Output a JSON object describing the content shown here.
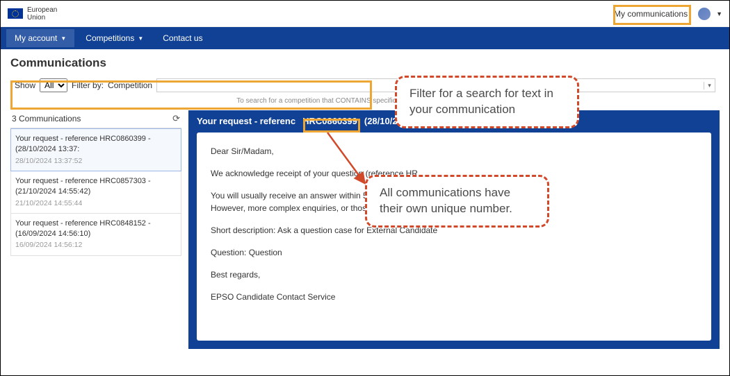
{
  "header": {
    "org_l1": "European",
    "org_l2": "Union",
    "my_comms": "My communications"
  },
  "nav": {
    "account": "My account",
    "competitions": "Competitions",
    "contact": "Contact us"
  },
  "page": {
    "title": "Communications",
    "show_label": "Show",
    "show_value": "All",
    "filter_label": "Filter by:",
    "filter_field": "Competition",
    "filter_hint": "To search for a competition that CONTAINS specific text, enter * before your search"
  },
  "sidebar": {
    "count_label": "3 Communications",
    "items": [
      {
        "title": "Your request - reference HRC0860399 - (28/10/2024 13:37:",
        "sub": "28/10/2024 13:37:52"
      },
      {
        "title": "Your request - reference HRC0857303 - (21/10/2024 14:55:42)",
        "sub": "21/10/2024 14:55:44"
      },
      {
        "title": "Your request - reference HRC0848152 - (16/09/2024 14:56:10)",
        "sub": "16/09/2024 14:56:12"
      }
    ]
  },
  "detail": {
    "h_prefix": "Your request - referenc",
    "h_ref": "HRC0860399",
    "h_suffix": "(28/10/2024 13:",
    "body": {
      "p1": "Dear Sir/Madam,",
      "p2": "We acknowledge receipt of your question (reference HR",
      "p3a": "You will usually receive an answer within 5 working days",
      "p3b": "However, more complex enquiries, or those requiring tr",
      "p4": "Short description: Ask a question case for External Candidate",
      "p5": "Question: Question",
      "p6": "Best regards,",
      "p7": "EPSO Candidate Contact Service"
    }
  },
  "callouts": {
    "c1": "Filter for a search for text in your communication",
    "c2": "All communications have their own unique number."
  }
}
